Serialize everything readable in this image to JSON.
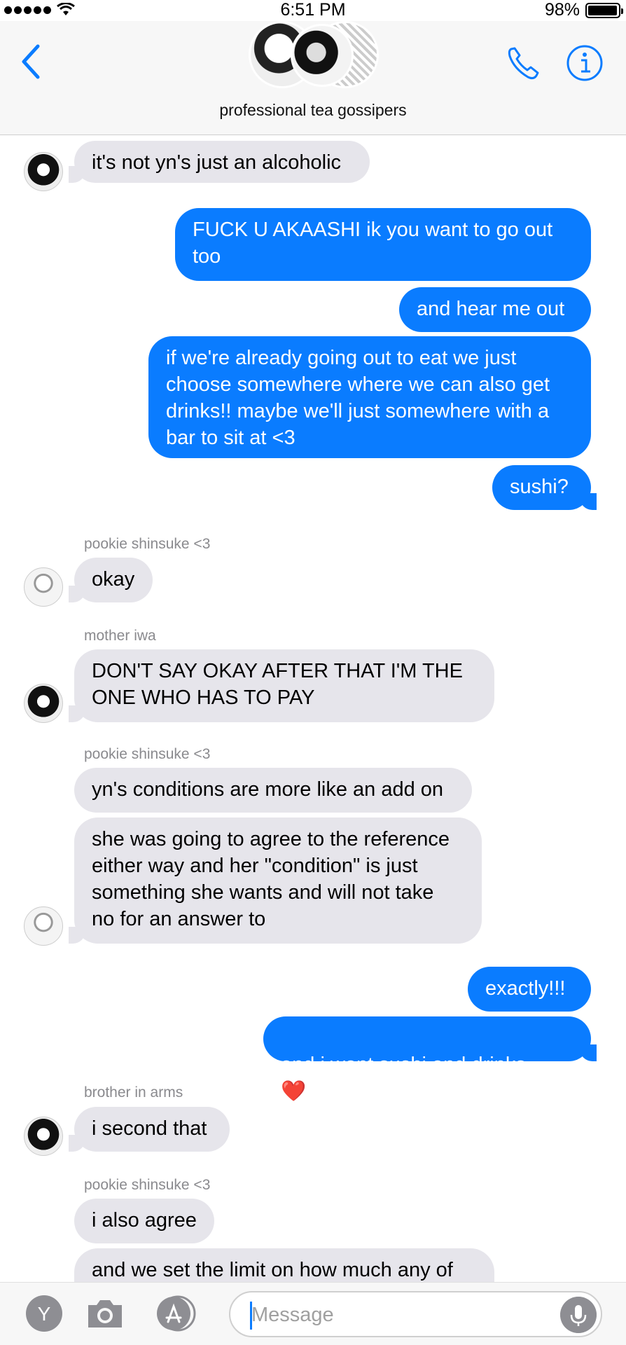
{
  "status_bar": {
    "time": "6:51 PM",
    "battery": "98%"
  },
  "header": {
    "group_name": "professional tea gossipers"
  },
  "messages": [
    {
      "text": "it's not yn's just an alcoholic"
    },
    {
      "text": "FUCK U AKAASHI ik you want to go out\ntoo"
    },
    {
      "text": "and hear me out"
    },
    {
      "text": "if we're already going out to eat we just\nchoose somewhere where we can also get\ndrinks!! maybe we'll just somewhere with a\nbar to sit at <3"
    },
    {
      "text": "sushi?"
    },
    {
      "sender": "pookie shinsuke <3",
      "text": "okay"
    },
    {
      "sender": "mother iwa",
      "text": "DON'T SAY OKAY AFTER THAT I'M THE\nONE WHO HAS TO PAY"
    },
    {
      "sender": "pookie shinsuke <3",
      "text": "yn's conditions are more like an add on"
    },
    {
      "text": "she was going to agree to the reference\neither way and her \"condition\" is just\nsomething she wants and will not take\nno for an answer to"
    },
    {
      "text": "exactly!!!"
    },
    {
      "text": "and i want sushi and drinks",
      "emoji": "❤️"
    },
    {
      "sender": "brother in arms",
      "text": "i second that"
    },
    {
      "sender": "pookie shinsuke <3",
      "text": "i also agree"
    },
    {
      "text": "and we set the limit on how much any of"
    }
  ],
  "input_bar": {
    "placeholder": "Message",
    "y_icon_label": "Y"
  },
  "colors": {
    "accent": "#0a7cff",
    "incoming": "#e6e5eb",
    "sender_gray": "#8a8a8e"
  },
  "icons": [
    "back-chevron-icon",
    "phone-icon",
    "info-icon",
    "camera-icon",
    "app-store-icon",
    "microphone-icon"
  ]
}
